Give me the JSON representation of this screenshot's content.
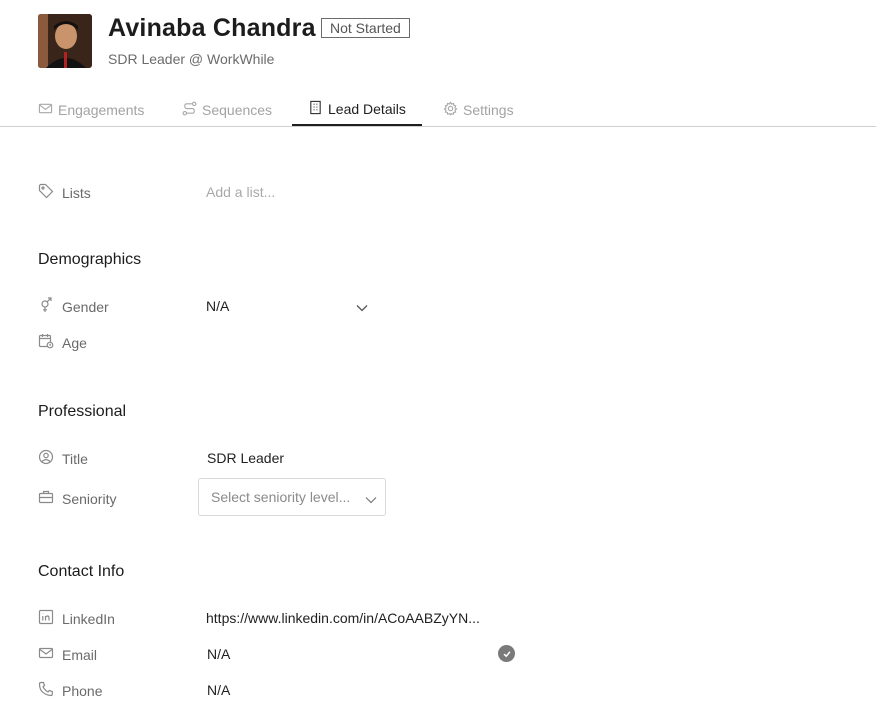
{
  "profile": {
    "name": "Avinaba Chandra",
    "status": "Not Started",
    "subtitle": "SDR Leader @ WorkWhile"
  },
  "tabs": [
    {
      "label": "Engagements",
      "active": false
    },
    {
      "label": "Sequences",
      "active": false
    },
    {
      "label": "Lead Details",
      "active": true
    },
    {
      "label": "Settings",
      "active": false
    }
  ],
  "lists": {
    "label": "Lists",
    "placeholder": "Add a list..."
  },
  "demographics": {
    "heading": "Demographics",
    "gender": {
      "label": "Gender",
      "value": "N/A"
    },
    "age": {
      "label": "Age",
      "value": ""
    }
  },
  "professional": {
    "heading": "Professional",
    "title": {
      "label": "Title",
      "value": "SDR Leader"
    },
    "seniority": {
      "label": "Seniority",
      "placeholder": "Select seniority level..."
    }
  },
  "contact": {
    "heading": "Contact Info",
    "linkedin": {
      "label": "LinkedIn",
      "value": "https://www.linkedin.com/in/ACoAABZyYN..."
    },
    "email": {
      "label": "Email",
      "value": "N/A"
    },
    "phone": {
      "label": "Phone",
      "value": "N/A"
    }
  },
  "icons": [
    "mail-icon",
    "sequences-icon",
    "building-icon",
    "gear-icon",
    "tag-icon",
    "gender-icon",
    "calendar-icon",
    "user-circle-icon",
    "briefcase-icon",
    "linkedin-icon",
    "phone-icon",
    "chevron-down-icon",
    "check-circle-icon"
  ]
}
